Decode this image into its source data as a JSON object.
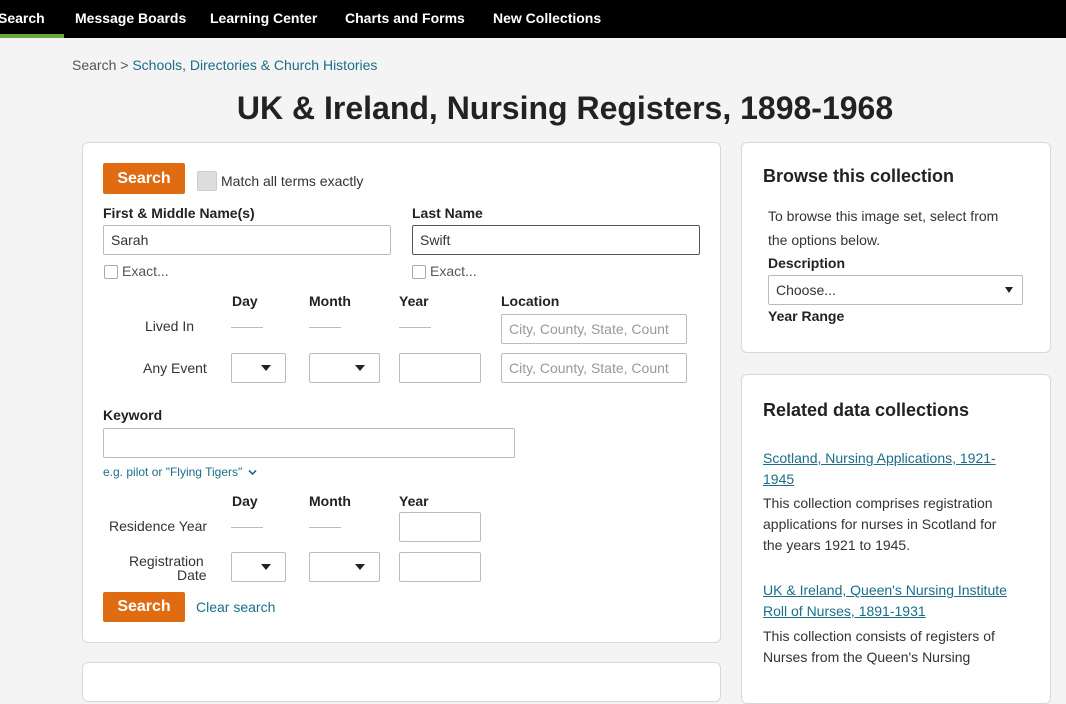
{
  "nav": {
    "items": [
      "Search",
      "Message Boards",
      "Learning Center",
      "Charts and Forms",
      "New Collections"
    ]
  },
  "breadcrumb": {
    "root": "Search",
    "separator": ">",
    "current": "Schools, Directories & Church Histories"
  },
  "page_title": "UK & Ireland, Nursing Registers, 1898-1968",
  "search_form": {
    "search_label": "Search",
    "match_exact_label": "Match all terms exactly",
    "first_name_label": "First & Middle Name(s)",
    "first_name_value": "Sarah",
    "last_name_label": "Last Name",
    "last_name_value": "Swift",
    "exact_label": "Exact...",
    "col_day": "Day",
    "col_month": "Month",
    "col_year": "Year",
    "col_location": "Location",
    "lived_in_label": "Lived In",
    "any_event_label": "Any Event",
    "location_placeholder": "City, County, State, Count",
    "keyword_label": "Keyword",
    "keyword_value": "",
    "keyword_hint": "e.g. pilot or \"Flying Tigers\"",
    "residence_year_label": "Residence Year",
    "registration_date_label_1": "Registration",
    "registration_date_label_2": "Date",
    "clear_search_label": "Clear search"
  },
  "browse": {
    "heading": "Browse this collection",
    "intro_line1": "To browse this image set, select from",
    "intro_line2": "the options below.",
    "description_label": "Description",
    "description_value": "Choose...",
    "year_range_label": "Year Range"
  },
  "related": {
    "heading": "Related data collections",
    "items": [
      {
        "title_lines": [
          "Scotland, Nursing Applications, 1921-",
          "1945"
        ],
        "desc_lines": [
          "This collection comprises registration",
          "applications for nurses in Scotland for",
          "the years 1921 to 1945."
        ]
      },
      {
        "title_lines": [
          "UK & Ireland, Queen's Nursing Institute",
          "Roll of Nurses, 1891-1931"
        ],
        "desc_lines": [
          "This collection consists of registers of",
          "Nurses from the Queen's Nursing"
        ]
      }
    ]
  },
  "colors": {
    "accent": "#e06b10",
    "link": "#1a6e8a",
    "nav_bg": "#000000",
    "nav_active": "#6aa63a"
  }
}
